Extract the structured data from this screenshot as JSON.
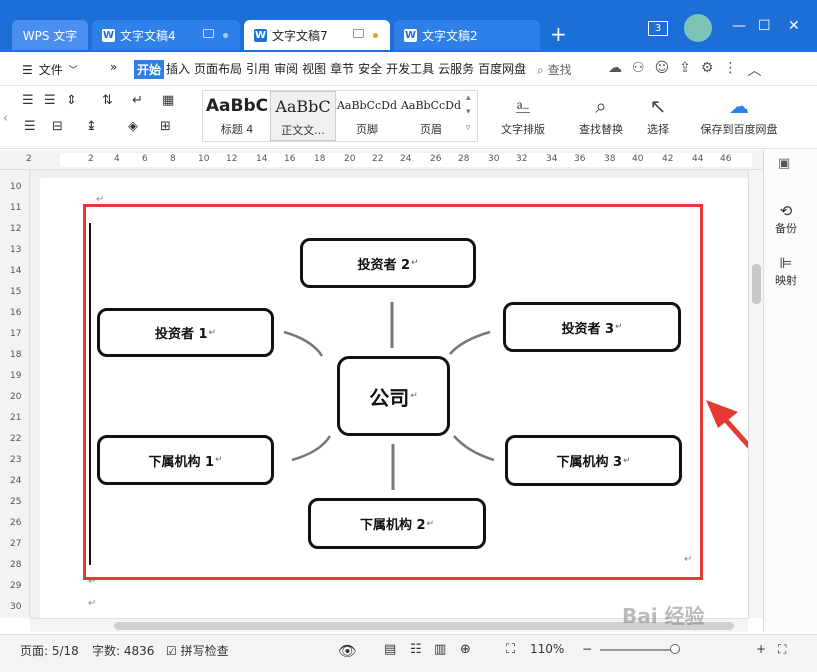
{
  "titlebar": {
    "tabs": [
      {
        "label": "WPS 文字"
      },
      {
        "label": "文字文稿4"
      },
      {
        "label": "文字文稿7"
      },
      {
        "label": "文字文稿2"
      }
    ],
    "new_tab": "+",
    "badge": "3",
    "minimize": "—",
    "maximize": "☐",
    "close": "✕",
    "accent": "#1d6fd8"
  },
  "menubar": {
    "file": "文件",
    "expand": "»",
    "items": [
      "开始",
      "插入",
      "页面布局",
      "引用",
      "审阅",
      "视图",
      "章节",
      "安全",
      "开发工具",
      "云服务",
      "百度网盘"
    ],
    "active": "开始",
    "search": "查找"
  },
  "ribbon": {
    "styles": [
      {
        "sample": "AaBbC",
        "label": "标题 4"
      },
      {
        "sample": "AaBbC",
        "label": "正文文..."
      },
      {
        "sample": "AaBbCcDd",
        "label": "页脚"
      },
      {
        "sample": "AaBbCcDd",
        "label": "页眉"
      }
    ],
    "tools": [
      {
        "icon": "text-layout-icon",
        "label": "文字排版"
      },
      {
        "icon": "find-replace-icon",
        "label": "查找替换"
      },
      {
        "icon": "select-icon",
        "label": "选择"
      },
      {
        "icon": "baidu-cloud-icon",
        "label": "保存到百度网盘"
      }
    ]
  },
  "ruler": {
    "ticks": [
      "2",
      "2",
      "4",
      "6",
      "8",
      "10",
      "12",
      "14",
      "16",
      "18",
      "20",
      "22",
      "24",
      "26",
      "28",
      "30",
      "32",
      "34",
      "36",
      "38",
      "40",
      "42",
      "44",
      "46"
    ]
  },
  "vruler": {
    "numbers": [
      "10",
      "11",
      "12",
      "13",
      "14",
      "15",
      "16",
      "17",
      "18",
      "19",
      "20",
      "21",
      "22",
      "23",
      "24",
      "25",
      "26",
      "27",
      "28",
      "29",
      "30"
    ]
  },
  "diagram": {
    "center": "公司",
    "top": "投资者 2",
    "left_top": "投资者 1",
    "right_top": "投资者 3",
    "left_bottom": "下属机构 1",
    "right_bottom": "下属机构 3",
    "bottom": "下属机构 2",
    "para_mark": "↵"
  },
  "sidepanel": {
    "backup": "备份",
    "mapping": "映射"
  },
  "statusbar": {
    "page": "页面: 5/18",
    "words": "字数: 4836",
    "spellcheck": "拼写检查",
    "zoom": "110%",
    "zoom_minus": "−",
    "zoom_plus": "+"
  },
  "watermark": "Bai 经验"
}
